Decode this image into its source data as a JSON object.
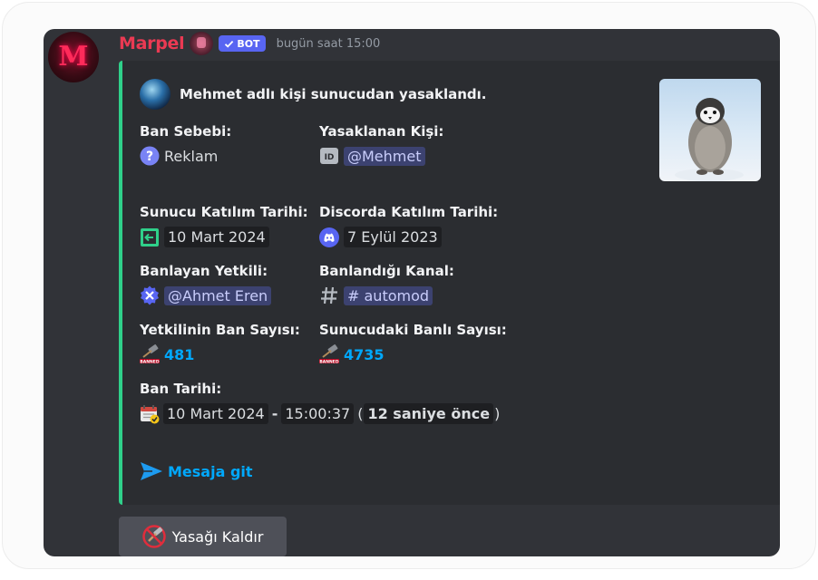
{
  "message": {
    "author": "Marpel",
    "bot_badge": "BOT",
    "timestamp": "bugün saat 15:00"
  },
  "embed": {
    "accent_color": "#2fd08a",
    "title": "Mehmet adlı kişi sunucudan yasaklandı.",
    "fields": {
      "ban_reason": {
        "name": "Ban Sebebi:",
        "value": "Reklam",
        "icon": "question-icon"
      },
      "banned_user": {
        "name": "Yasaklanan Kişi:",
        "value": "@Mehmet",
        "icon": "id-icon"
      },
      "server_join": {
        "name": "Sunucu Katılım Tarihi:",
        "value": "10 Mart 2024",
        "icon": "join-icon"
      },
      "discord_join": {
        "name": "Discorda Katılım Tarihi:",
        "value": "7 Eylül 2023",
        "icon": "discord-icon"
      },
      "moderator": {
        "name": "Banlayan Yetkili:",
        "value": "@Ahmet Eren",
        "icon": "moderator-icon"
      },
      "channel": {
        "name": "Banlandığı Kanal:",
        "value": "# automod",
        "icon": "hashtag-icon"
      },
      "mod_ban_count": {
        "name": "Yetkilinin Ban Sayısı:",
        "value": "481",
        "icon": "ban-hammer-icon"
      },
      "server_ban_count": {
        "name": "Sunucudaki Banlı Sayısı:",
        "value": "4735",
        "icon": "ban-hammer-icon"
      },
      "ban_date": {
        "name": "Ban Tarihi:",
        "date": "10 Mart 2024",
        "separator": "-",
        "time": "15:00:37",
        "paren_open": "(",
        "relative": "12 saniye önce",
        "paren_close": ")",
        "icon": "calendar-icon"
      }
    },
    "jump_link": "Mesaja git"
  },
  "button": {
    "label": "Yasağı Kaldır",
    "icon": "unban-icon"
  }
}
